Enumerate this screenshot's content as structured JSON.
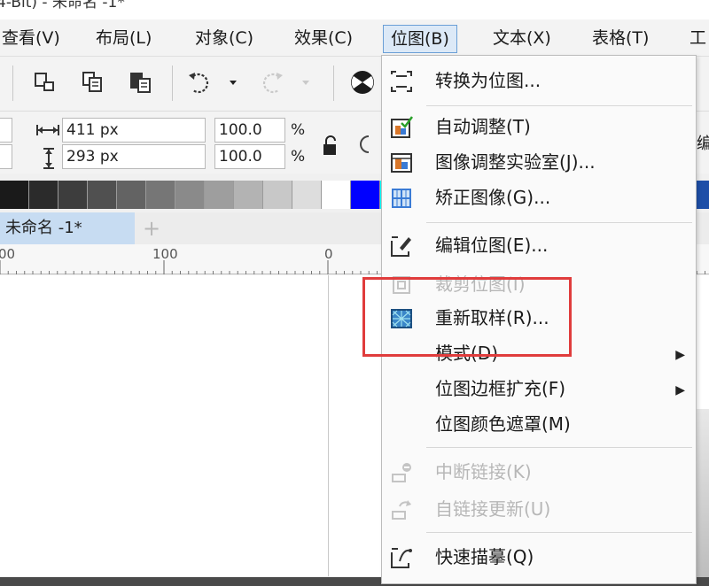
{
  "titlebar": {
    "text": "4-Bit) - 未命名 -1*"
  },
  "menubar": {
    "items": [
      {
        "label": "查看(V)"
      },
      {
        "label": "布局(L)"
      },
      {
        "label": "对象(C)"
      },
      {
        "label": "效果(C)"
      },
      {
        "label": "位图(B)"
      },
      {
        "label": "文本(X)"
      },
      {
        "label": "表格(T)"
      },
      {
        "label": "工"
      }
    ]
  },
  "propbar": {
    "width": "411 px",
    "height": "293 px",
    "scale_x": "100.0",
    "scale_y": "100.0",
    "percent": "%",
    "right_char": "编"
  },
  "tabs": {
    "doc": "未命名 -1*",
    "add": "+"
  },
  "ruler": {
    "labels": [
      "00",
      "100",
      "0"
    ]
  },
  "dropdown": {
    "items": [
      {
        "label": "转换为位图...",
        "icon": "convert-bitmap-icon",
        "disabled": false
      },
      {
        "label": "自动调整(T)",
        "icon": "auto-adjust-icon",
        "disabled": false
      },
      {
        "label": "图像调整实验室(J)...",
        "icon": "image-adjust-lab-icon",
        "disabled": false
      },
      {
        "label": "矫正图像(G)...",
        "icon": "straighten-image-icon",
        "disabled": false
      },
      {
        "label": "编辑位图(E)...",
        "icon": "edit-bitmap-icon",
        "disabled": false
      },
      {
        "label": "裁剪位图(I)",
        "icon": "crop-bitmap-icon",
        "disabled": true
      },
      {
        "label": "重新取样(R)...",
        "icon": "resample-icon",
        "disabled": false
      },
      {
        "label": "模式(D)",
        "icon": "",
        "disabled": false,
        "submenu": true
      },
      {
        "label": "位图边框扩充(F)",
        "icon": "",
        "disabled": false,
        "submenu": true
      },
      {
        "label": "位图颜色遮罩(M)",
        "icon": "",
        "disabled": false
      },
      {
        "label": "中断链接(K)",
        "icon": "break-link-icon",
        "disabled": true
      },
      {
        "label": "自链接更新(U)",
        "icon": "update-link-icon",
        "disabled": true
      },
      {
        "label": "快速描摹(Q)",
        "icon": "quick-trace-icon",
        "disabled": false
      }
    ]
  },
  "palette": [
    "#1a1a1a",
    "#2b2b2b",
    "#3d3d3d",
    "#505050",
    "#636363",
    "#767676",
    "#8a8a8a",
    "#9e9e9e",
    "#b3b3b3",
    "#c8c8c8",
    "#dddddd",
    "#ffffff",
    "#0000ff",
    "#00ffff",
    "#00ff00",
    "#ffff00"
  ],
  "colors": {
    "highlight": "#e03c3c",
    "menu_active": "#dce9f7"
  }
}
